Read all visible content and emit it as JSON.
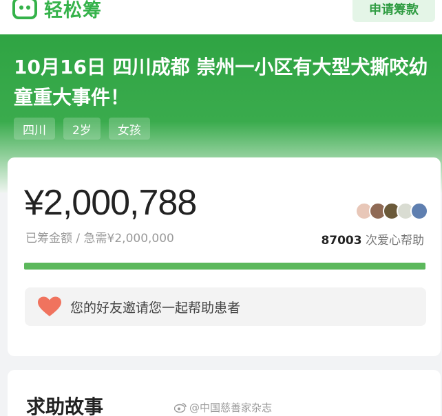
{
  "header": {
    "logo_text": "轻松筹",
    "apply_button": "申请筹款"
  },
  "hero": {
    "title": "10月16日 四川成都 崇州一小区有大型犬撕咬幼童重大事件！",
    "tags": [
      "四川",
      "2岁",
      "女孩"
    ]
  },
  "fundraising": {
    "amount": "¥2,000,788",
    "raised_label": "已筹金额 / 急需¥2,000,000",
    "helpers_count": "87003",
    "helpers_suffix": " 次爱心帮助",
    "progress_fraction": 1.0,
    "invite_text": "您的好友邀请您一起帮助患者"
  },
  "story": {
    "title": "求助故事"
  },
  "watermark": {
    "text": "@中国慈善家杂志"
  },
  "colors": {
    "brand_green": "#35b24a",
    "progress_green": "#5cb85c",
    "heart": "#f0735e"
  }
}
